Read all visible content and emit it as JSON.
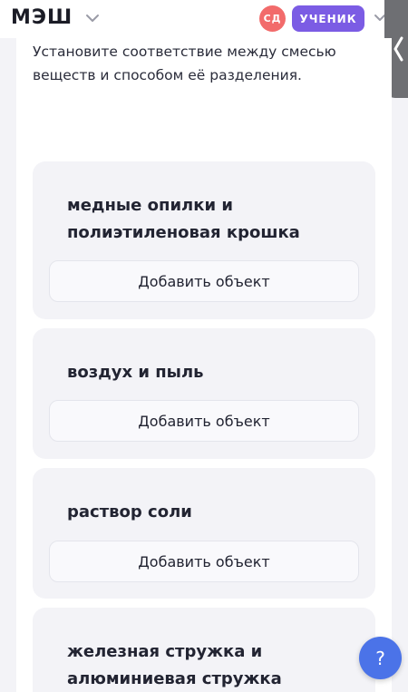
{
  "header": {
    "logo": "МЭШ",
    "avatar_initials": "СД",
    "role_label": "УЧЕНИК",
    "accent_color": "#7b5ce4",
    "avatar_color": "#f26b6b"
  },
  "question": {
    "text": "Установите соответствие между смесью веществ и способом её разделения."
  },
  "cards": [
    {
      "title": "медные опилки и полиэтиленовая крошка",
      "button_label": "Добавить объект"
    },
    {
      "title": "воздух и пыль",
      "button_label": "Добавить объект"
    },
    {
      "title": "раствор соли",
      "button_label": "Добавить объект"
    },
    {
      "title": "железная стружка и алюминиевая стружка",
      "button_label": "Добавить объект"
    }
  ],
  "help": {
    "label": "?",
    "color": "#4b73e8"
  },
  "icons": [
    "chevron-down-icon",
    "chevron-left-icon"
  ]
}
